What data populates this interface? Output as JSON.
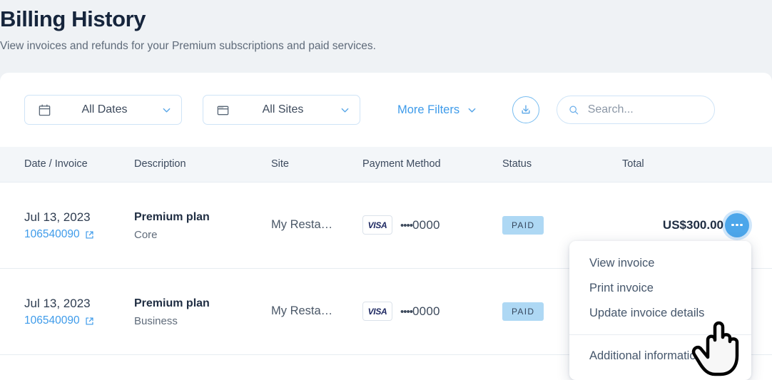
{
  "header": {
    "title": "Billing History",
    "subtitle": "View invoices and refunds for your Premium subscriptions and paid services."
  },
  "toolbar": {
    "date_filter": {
      "label": "All Dates",
      "icon": "calendar-icon"
    },
    "site_filter": {
      "label": "All Sites",
      "icon": "window-icon"
    },
    "more_filters_label": "More Filters",
    "download_icon": "download-icon",
    "search": {
      "placeholder": "Search...",
      "value": "",
      "icon": "search-icon"
    }
  },
  "table": {
    "columns": [
      "Date / Invoice",
      "Description",
      "Site",
      "Payment Method",
      "Status",
      "Total"
    ],
    "rows": [
      {
        "date": "Jul 13, 2023",
        "invoice": "106540090",
        "description": "Premium plan",
        "plan": "Core",
        "site": "My Resta…",
        "card_brand": "VISA",
        "card_digits": "0000",
        "card_mask": "••••",
        "status": "PAID",
        "total": "US$300.00"
      },
      {
        "date": "Jul 13, 2023",
        "invoice": "106540090",
        "description": "Premium plan",
        "plan": "Business",
        "site": "My Resta…",
        "card_brand": "VISA",
        "card_digits": "0000",
        "card_mask": "••••",
        "status": "PAID",
        "total": ""
      }
    ]
  },
  "context_menu": {
    "items": [
      "View invoice",
      "Print invoice",
      "Update invoice details"
    ],
    "footer_items": [
      "Additional information"
    ]
  },
  "colors": {
    "page_background": "#eff2f5",
    "accent_blue": "#3e9bea",
    "active_button": "#4ca6ea",
    "badge_paid_bg": "#aed8f4",
    "title_color": "#16253c"
  }
}
